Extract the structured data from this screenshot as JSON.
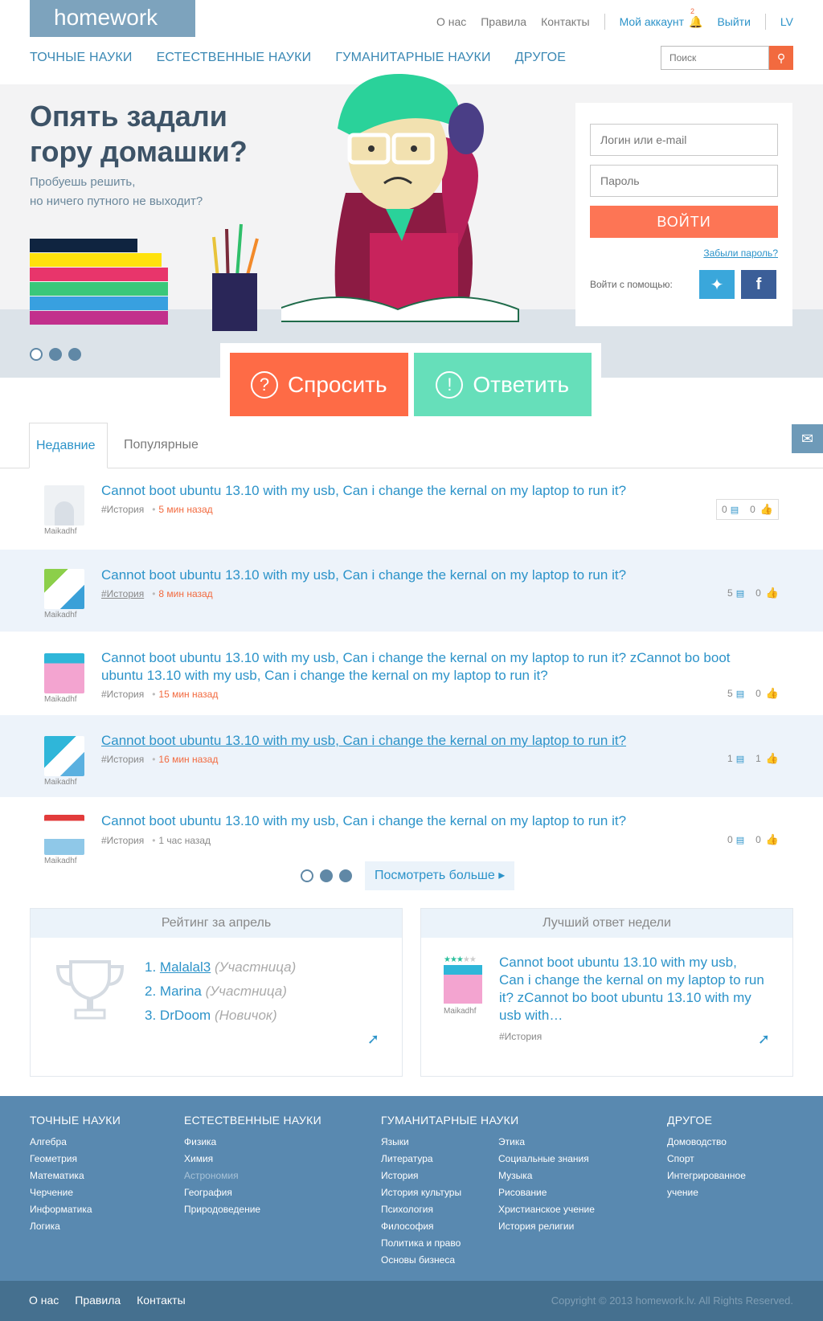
{
  "header": {
    "logo": "homework",
    "top_links": {
      "about": "О нас",
      "rules": "Правила",
      "contacts": "Контакты",
      "account": "Мой аккаунт",
      "notifications_count": "2",
      "logout": "Выйти",
      "lang": "LV"
    },
    "categories": [
      "ТОЧНЫЕ НАУКИ",
      "ЕСТЕСТВЕННЫЕ НАУКИ",
      "ГУМАНИТАРНЫЕ НАУКИ",
      "ДРУГОЕ"
    ],
    "search_placeholder": "Поиск"
  },
  "hero": {
    "title_line1": "Опять задали",
    "title_line2": "гору домашки?",
    "subtitle_line1": "Пробуешь решить,",
    "subtitle_line2": "но ничего путного не выходит?"
  },
  "login": {
    "login_placeholder": "Логин или e-mail",
    "password_placeholder": "Пароль",
    "submit": "ВОЙТИ",
    "forgot": "Забыли пароль?",
    "social_label": "Войти с помощью:"
  },
  "actions": {
    "ask": "Спросить",
    "answer": "Ответить"
  },
  "tabs": {
    "recent": "Недавние",
    "popular": "Популярные"
  },
  "questions": [
    {
      "user": "Maikadhf",
      "title": "Cannot boot ubuntu 13.10 with my usb, Can i change the kernal on my laptop to run it?",
      "tag": "#История",
      "time": "5 мин назад",
      "comments": "0",
      "likes": "0"
    },
    {
      "user": "Maikadhf",
      "title": "Cannot boot ubuntu 13.10 with my usb, Can i change the kernal on my laptop to run it?",
      "tag": "#История",
      "time": "8 мин назад",
      "comments": "5",
      "likes": "0"
    },
    {
      "user": "Maikadhf",
      "title": "Cannot boot ubuntu 13.10 with my usb, Can i change the kernal on my laptop to run it? zCannot bo boot ubuntu 13.10 with my usb, Can i change the kernal on my laptop to run it?",
      "tag": "#История",
      "time": "15 мин назад",
      "comments": "5",
      "likes": "0"
    },
    {
      "user": "Maikadhf",
      "title": "Cannot boot ubuntu 13.10 with my usb, Can i change the kernal on my laptop to run it?",
      "tag": "#История",
      "time": "16 мин назад",
      "comments": "1",
      "likes": "1"
    },
    {
      "user": "Maikadhf",
      "title": "Cannot boot ubuntu 13.10 with my usb, Can i change the kernal on my laptop to run it?",
      "tag": "#История",
      "time": "1 час назад",
      "comments": "0",
      "likes": "0"
    }
  ],
  "more_button": "Посмотреть больше ▸",
  "rating": {
    "title": "Рейтинг за апрель",
    "entries": [
      {
        "rank": "1.",
        "name": "Malalal3",
        "role": "(Участница)"
      },
      {
        "rank": "2.",
        "name": "Marina",
        "role": "(Участница)"
      },
      {
        "rank": "3.",
        "name": "DrDoom",
        "role": "(Новичок)"
      }
    ]
  },
  "best_answer": {
    "title": "Лучший ответ недели",
    "text": "Cannot boot ubuntu 13.10 with my usb, Can i change the kernal on my laptop to run it? zCannot bo boot ubuntu 13.10 with my usb with…",
    "user": "Maikadhf",
    "tag": "#История"
  },
  "footer": {
    "col1": {
      "title": "ТОЧНЫЕ НАУКИ",
      "items": [
        "Алгебра",
        "Геометрия",
        "Математика",
        "Черчение",
        "Информатика",
        "Логика"
      ]
    },
    "col2": {
      "title": "ЕСТЕСТВЕННЫЕ НАУКИ",
      "items": [
        "Физика",
        "Химия",
        "Астрономия",
        "География",
        "Природоведение"
      ]
    },
    "col3": {
      "title": "ГУМАНИТАРНЫЕ НАУКИ",
      "items": [
        "Языки",
        "Литература",
        "История",
        "История культуры",
        "Психология",
        "Философия",
        "Политика и право",
        "Основы бизнеса"
      ]
    },
    "col4": {
      "items": [
        "Этика",
        "Социальные знания",
        "Музыка",
        "Рисование",
        "Христианское учение",
        "История религии"
      ]
    },
    "col5": {
      "title": "ДРУГОЕ",
      "items": [
        "Домоводство",
        "Спорт",
        "Интегрированное учение"
      ]
    },
    "bottom_links": [
      "О нас",
      "Правила",
      "Контакты"
    ],
    "copyright": "Copyright © 2013 homework.lv. All Rights Reserved."
  }
}
